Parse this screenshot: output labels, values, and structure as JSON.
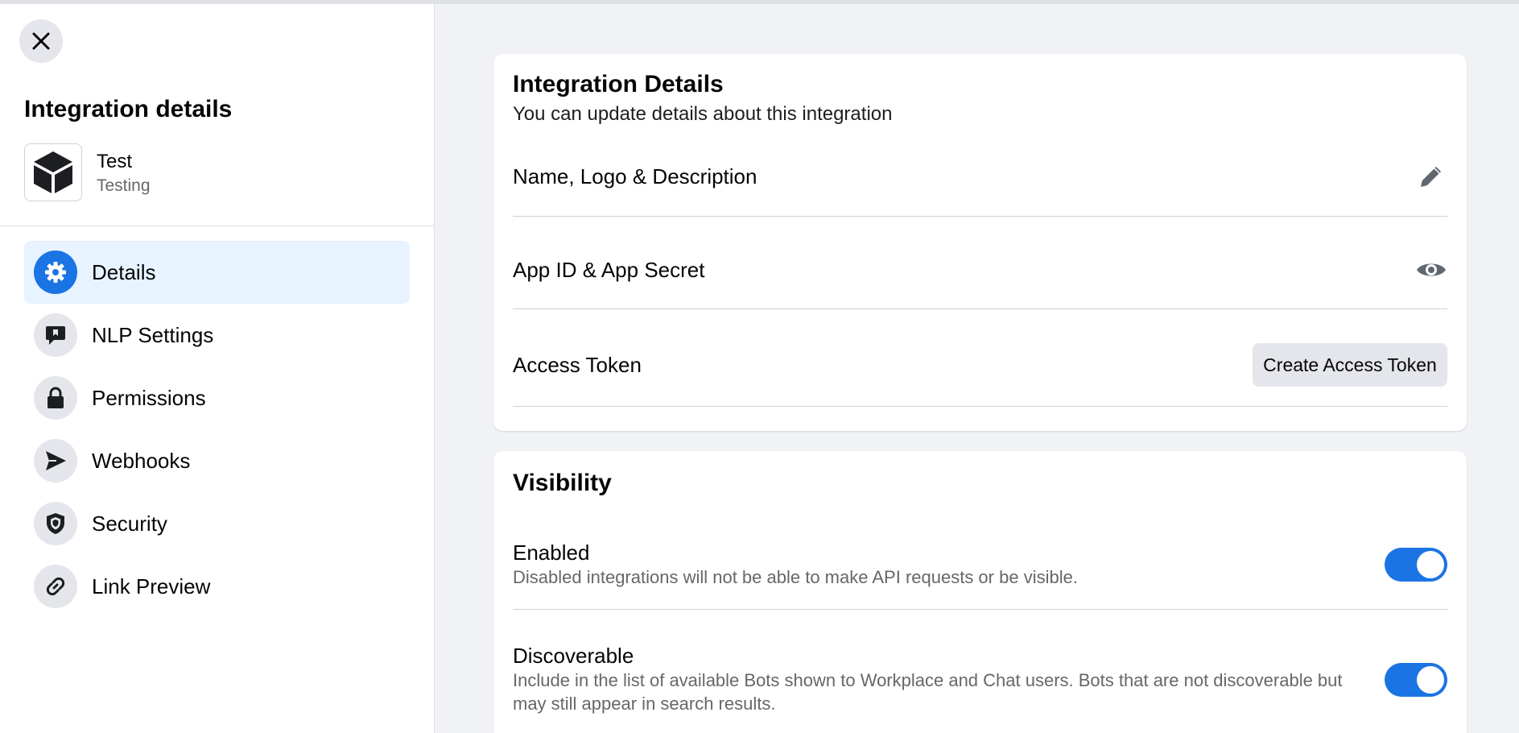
{
  "sidebar": {
    "title": "Integration details",
    "app": {
      "name": "Test",
      "description": "Testing"
    },
    "items": [
      {
        "label": "Details",
        "icon": "gear-icon",
        "active": true
      },
      {
        "label": "NLP Settings",
        "icon": "speech-bubble-icon",
        "active": false
      },
      {
        "label": "Permissions",
        "icon": "lock-icon",
        "active": false
      },
      {
        "label": "Webhooks",
        "icon": "send-icon",
        "active": false
      },
      {
        "label": "Security",
        "icon": "shield-icon",
        "active": false
      },
      {
        "label": "Link Preview",
        "icon": "link-icon",
        "active": false
      }
    ]
  },
  "integration_details": {
    "title": "Integration Details",
    "subtitle": "You can update details about this integration",
    "rows": {
      "name_logo": "Name, Logo & Description",
      "app_id": "App ID & App Secret",
      "access_token": "Access Token"
    },
    "create_token_label": "Create Access Token"
  },
  "visibility": {
    "title": "Visibility",
    "enabled": {
      "label": "Enabled",
      "description": "Disabled integrations will not be able to make API requests or be visible.",
      "on": true
    },
    "discoverable": {
      "label": "Discoverable",
      "description": "Include in the list of available Bots shown to Workplace and Chat users. Bots that are not discoverable but may still appear in search results.",
      "on": true
    }
  },
  "colors": {
    "accent": "#1b74e4",
    "active_bg": "#e7f3ff",
    "icon_bg": "#e4e6eb"
  }
}
